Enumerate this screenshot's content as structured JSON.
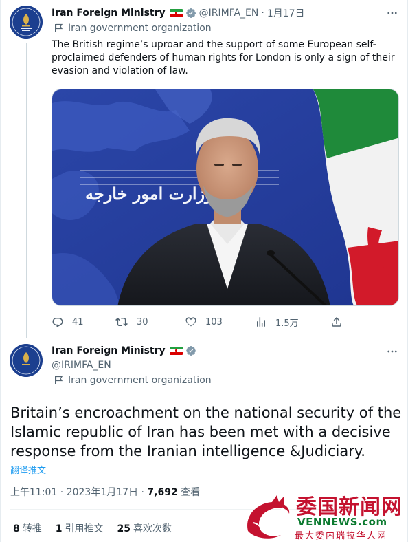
{
  "tweet1": {
    "author_name": "Iran Foreign Ministry",
    "handle": "@IRIMFA_EN",
    "separator": "·",
    "date": "1月17日",
    "org_label": "Iran government organization",
    "text": "The British regime’s uproar and the support of some European self-proclaimed defenders of human rights for London is only a sign of their evasion and violation of law.",
    "media_text": "وزارت امور خارجه",
    "actions": {
      "replies": "41",
      "retweets": "30",
      "likes": "103",
      "views": "1.5万"
    }
  },
  "tweet2": {
    "author_name": "Iran Foreign Ministry",
    "handle": "@IRIMFA_EN",
    "org_label": "Iran government organization",
    "text": "Britain’s encroachment on the national security of the Islamic republic of Iran has been met with a decisive response from the Iranian intelligence &Judiciary.",
    "translate_label": "翻译推文",
    "timestamp": "上午11:01 · 2023年1月17日 · ",
    "views_count": "7,692",
    "views_label": " 查看",
    "stats": {
      "retweets_count": "8",
      "retweets_label": "转推",
      "quotes_count": "1",
      "quotes_label": "引用推文",
      "likes_count": "25",
      "likes_label": "喜欢次数"
    }
  },
  "watermark": {
    "title": "委国新闻网",
    "site": "VENNEWS.com",
    "subtitle": "最大委内瑞拉华人网"
  },
  "colors": {
    "text_primary": "#0f1419",
    "text_secondary": "#536471",
    "accent": "#1d9bf0",
    "verified": "#829aab",
    "watermark_red": "#c4122f",
    "watermark_green": "#0b7a2f"
  },
  "icons": [
    "reply-icon",
    "retweet-icon",
    "like-icon",
    "views-icon",
    "share-icon",
    "more-icon",
    "verified-icon",
    "flag-icon",
    "iran-flag-emoji"
  ]
}
